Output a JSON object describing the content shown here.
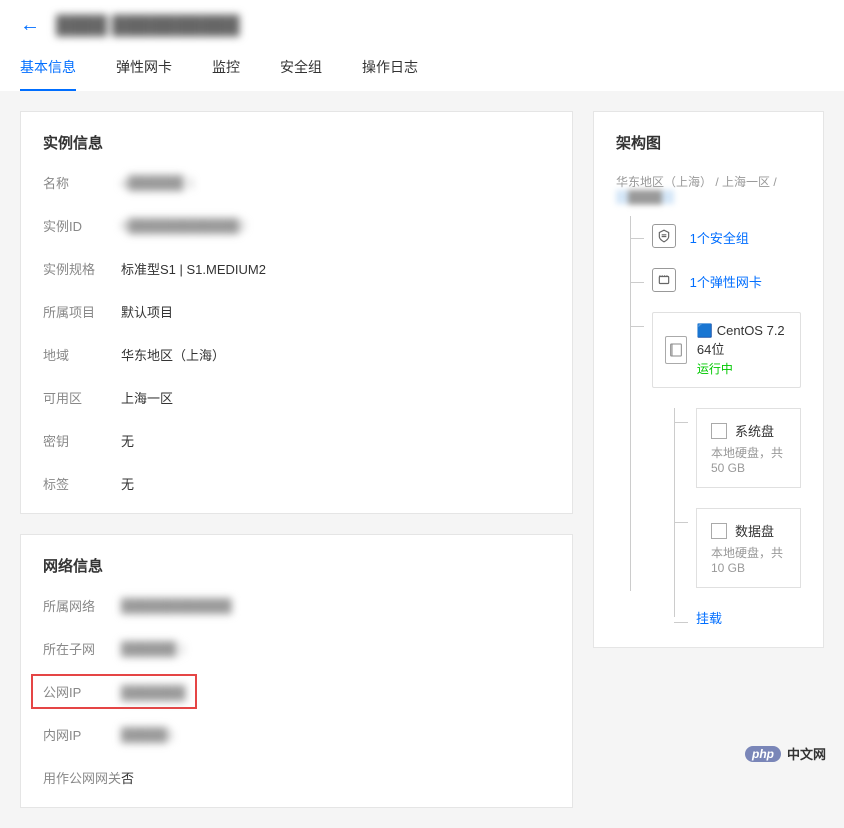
{
  "header": {
    "title_blur": "████ ██████████"
  },
  "tabs": [
    {
      "label": "基本信息",
      "active": true
    },
    {
      "label": "弹性网卡",
      "active": false
    },
    {
      "label": "监控",
      "active": false
    },
    {
      "label": "安全组",
      "active": false
    },
    {
      "label": "操作日志",
      "active": false
    }
  ],
  "instanceInfo": {
    "title": "实例信息",
    "rows": [
      {
        "label": "名称",
        "value": "a██████ 1",
        "blurred": true
      },
      {
        "label": "实例ID",
        "value": "6████████████2",
        "blurred": true
      },
      {
        "label": "实例规格",
        "value": "标准型S1 | S1.MEDIUM2",
        "blurred": false
      },
      {
        "label": "所属项目",
        "value": "默认项目",
        "blurred": false
      },
      {
        "label": "地域",
        "value": "华东地区（上海）",
        "blurred": false
      },
      {
        "label": "可用区",
        "value": "上海一区",
        "blurred": false
      },
      {
        "label": "密钥",
        "value": "无",
        "blurred": false
      },
      {
        "label": "标签",
        "value": "无",
        "blurred": false
      }
    ]
  },
  "networkInfo": {
    "title": "网络信息",
    "rows": [
      {
        "label": "所属网络",
        "value": "████████████",
        "blurred": true,
        "highlight": false
      },
      {
        "label": "所在子网",
        "value": "██████ )",
        "blurred": true,
        "highlight": false
      },
      {
        "label": "公网IP",
        "value": "███████",
        "blurred": true,
        "highlight": true
      },
      {
        "label": "内网IP",
        "value": "█████1",
        "blurred": true,
        "highlight": false
      },
      {
        "label": "用作公网网关",
        "value": "否",
        "blurred": false,
        "highlight": false
      }
    ]
  },
  "architecture": {
    "title": "架构图",
    "breadcrumb": {
      "region": "华东地区（上海）",
      "zone": "上海一区",
      "tail": "████"
    },
    "securityGroup": {
      "label": "1个安全组",
      "icon": "shield-icon"
    },
    "eni": {
      "label": "1个弹性网卡",
      "icon": "nic-icon"
    },
    "os": {
      "name": "CentOS 7.2 64位",
      "status": "运行中"
    },
    "disks": [
      {
        "name": "系统盘",
        "detail": "本地硬盘，共 50 GB"
      },
      {
        "name": "数据盘",
        "detail": "本地硬盘，共 10 GB"
      }
    ],
    "mountLink": "挂载"
  },
  "footer": {
    "php": "php",
    "site": "中文网"
  }
}
